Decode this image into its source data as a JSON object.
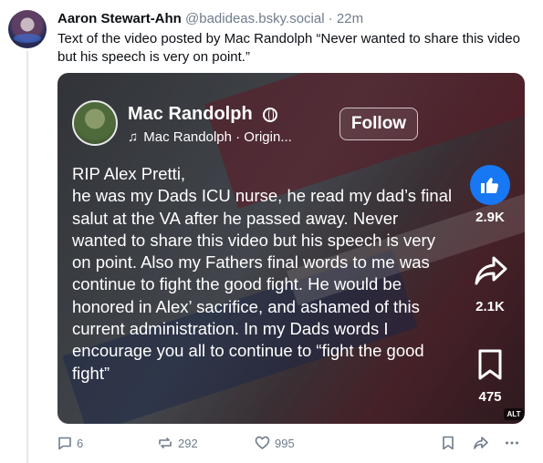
{
  "post": {
    "author_name": "Aaron Stewart-Ahn",
    "handle": "@badideas.bsky.social",
    "separator": "·",
    "time": "22m",
    "text": "Text of the video posted by Mac Randolph “Never wanted to share this video but his speech is very on point.”"
  },
  "video": {
    "creator_name": "Mac Randolph",
    "music_label": "Mac Randolph · Origin...",
    "follow_label": "Follow",
    "overlay_text": "RIP Alex Pretti,\nhe was my Dads ICU nurse, he read my dad’s final salut at the VA after he passed away. Never wanted to share this video but his speech is very on point. Also my Fathers final words to me was continue to fight the good fight. He would be honored in Alex’ sacrifice, and ashamed of this current administration. In my Dads words I encourage you all to continue to “fight the good fight”",
    "likes": "2.9K",
    "shares": "2.1K",
    "saves": "475",
    "alt_badge": "ALT"
  },
  "actions": {
    "replies": "6",
    "reposts": "292",
    "likes": "995"
  },
  "colors": {
    "like_blue": "#1877f2",
    "muted_text": "#6f7c8c"
  }
}
